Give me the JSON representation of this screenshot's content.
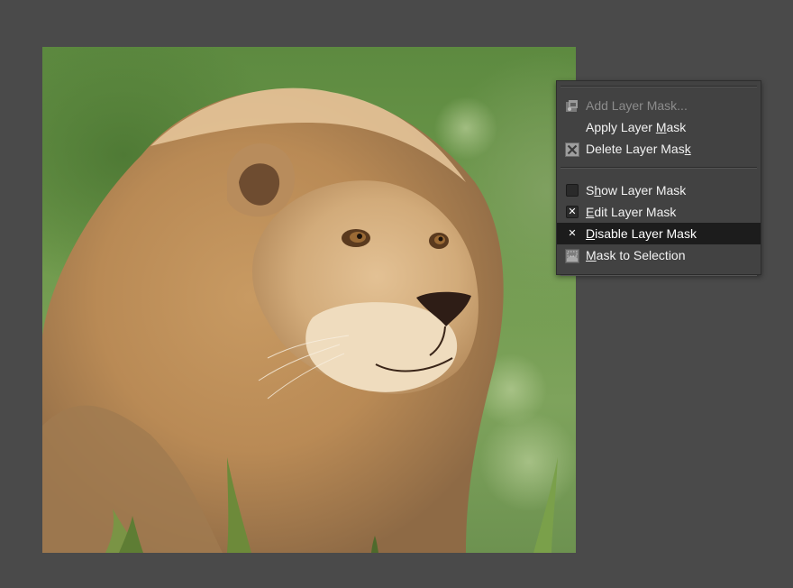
{
  "menu": {
    "items": [
      {
        "label_pre": "Add Layer Mask...",
        "mnemonic": "",
        "label_post": "",
        "icon": "add-layer-mask-icon",
        "enabled": false
      },
      {
        "label_pre": "Apply Layer ",
        "mnemonic": "M",
        "label_post": "ask",
        "icon": "",
        "enabled": true
      },
      {
        "label_pre": "Delete Layer Mas",
        "mnemonic": "k",
        "label_post": "",
        "icon": "delete-icon",
        "enabled": true
      },
      {
        "label_pre": "S",
        "mnemonic": "h",
        "label_post": "ow Layer Mask",
        "check": "unchecked",
        "enabled": true
      },
      {
        "label_pre": "",
        "mnemonic": "E",
        "label_post": "dit Layer Mask",
        "check": "checked",
        "enabled": true
      },
      {
        "label_pre": "",
        "mnemonic": "D",
        "label_post": "isable Layer Mask",
        "check": "checked",
        "enabled": true,
        "highlighted": true
      },
      {
        "label_pre": "",
        "mnemonic": "M",
        "label_post": "ask to Selection",
        "icon": "mask-to-selection-icon",
        "enabled": true
      }
    ],
    "check_mark": "✕"
  },
  "colors": {
    "canvas_bg": "#4a4a4a",
    "menu_bg": "#424242",
    "highlight_bg": "#1c1c1c",
    "text": "#f2f2f2",
    "disabled_text": "#8c8c8c"
  }
}
